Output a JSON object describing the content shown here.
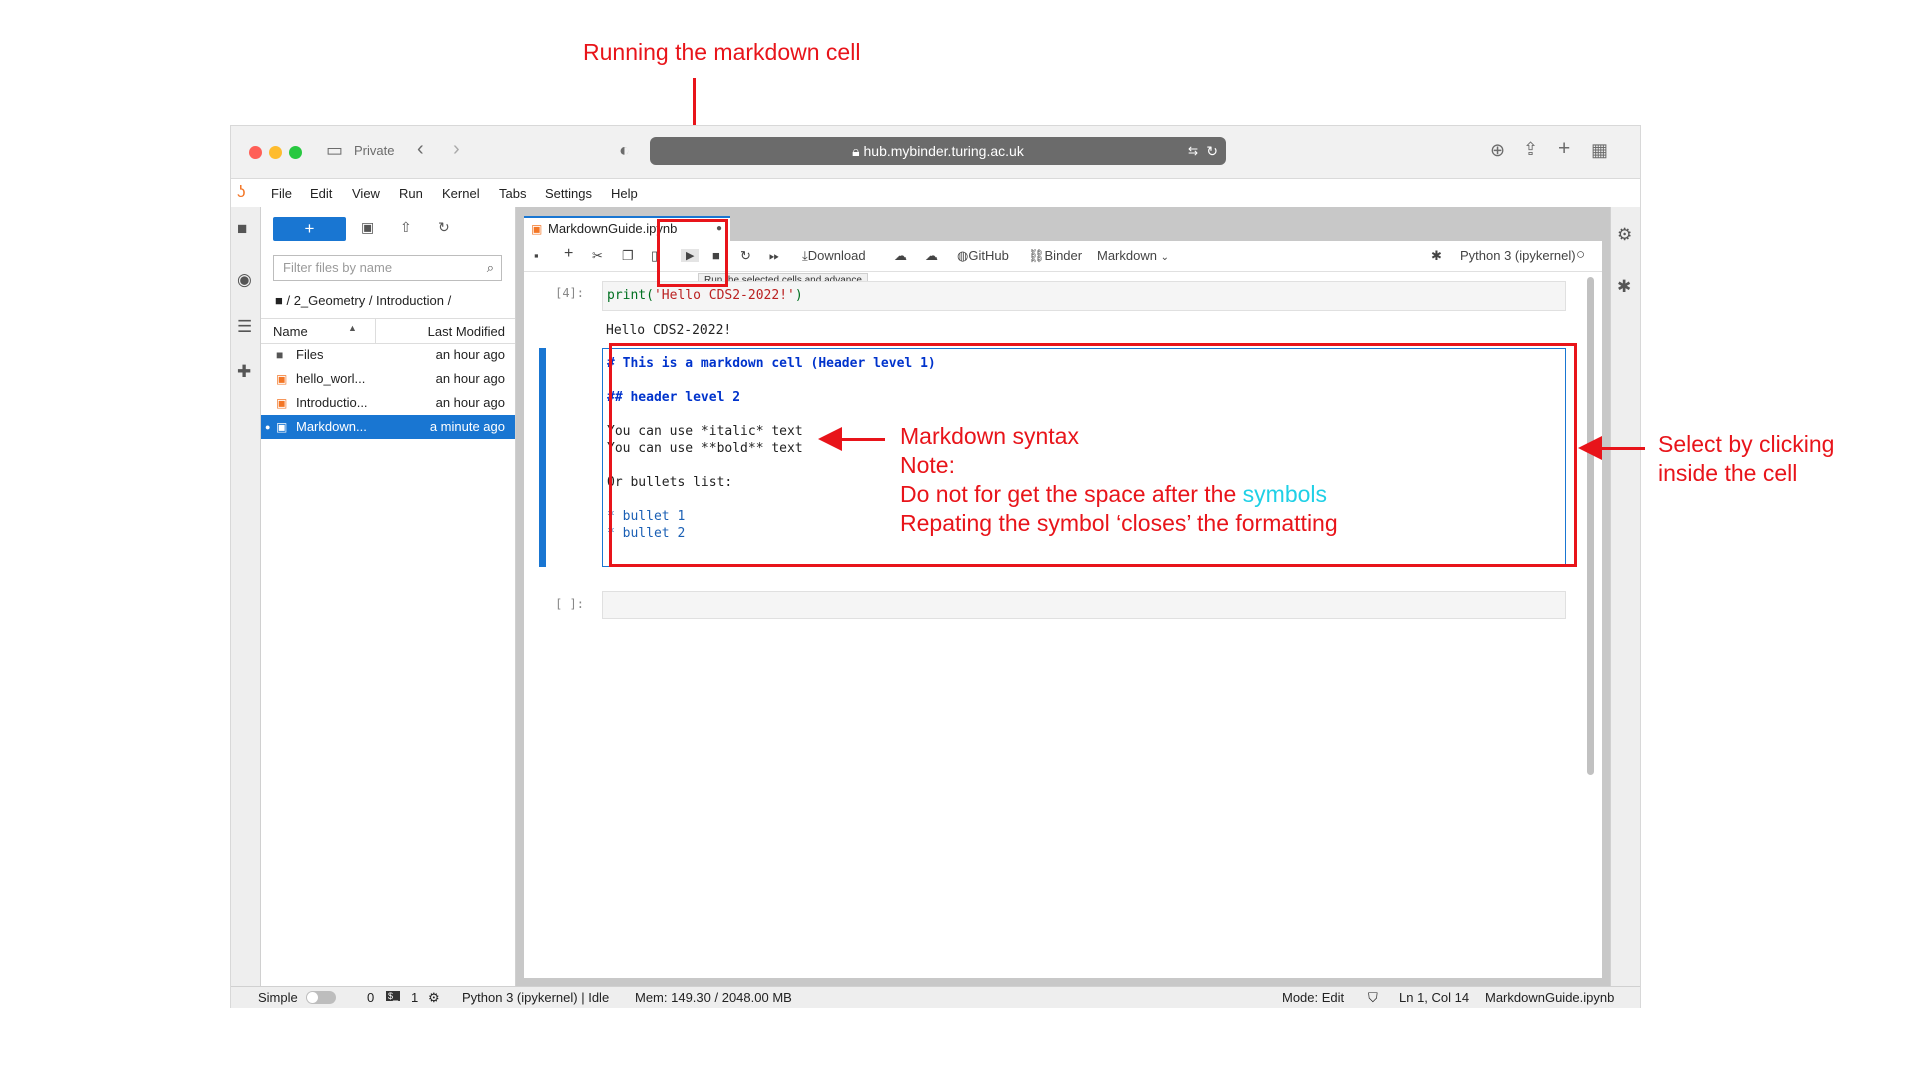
{
  "annotations": {
    "top_label": "Running the markdown cell",
    "syntax_title": "Markdown syntax",
    "note": "Note:",
    "space_note_prefix": "Do not for get the space  after the ",
    "space_note_highlight": "symbols",
    "repeat_note": "Repating the symbol ‘closes’ the formatting",
    "select_note_line1": "Select by clicking",
    "select_note_line2": "inside the cell"
  },
  "browser": {
    "private_label": "Private",
    "url": "hub.mybinder.turing.ac.uk",
    "lock_icon": "lock-icon"
  },
  "menu": [
    "File",
    "Edit",
    "View",
    "Run",
    "Kernel",
    "Tabs",
    "Settings",
    "Help"
  ],
  "filebrowser": {
    "new_label": "+",
    "filter_placeholder": "Filter files by name",
    "breadcrumb": "/ 2_Geometry / Introduction /",
    "col_name": "Name",
    "col_modified": "Last Modified",
    "rows": [
      {
        "name": "Files",
        "modified": "an hour ago"
      },
      {
        "name": "hello_worl...",
        "modified": "an hour ago"
      },
      {
        "name": "Introductio...",
        "modified": "an hour ago"
      },
      {
        "name": "Markdown...",
        "modified": "a minute ago"
      }
    ]
  },
  "notebook": {
    "tab_title": "MarkdownGuide.ipynb",
    "toolbar": {
      "download": "Download",
      "github": "GitHub",
      "binder": "Binder",
      "cell_type": "Markdown",
      "kernel": "Python 3 (ipykernel)"
    },
    "tooltip": "Run the selected cells and advance",
    "code_prompt": "[4]:",
    "code_src_fn": "print(",
    "code_src_str": "'Hello CDS2-2022!'",
    "code_src_end": ")",
    "code_output": "Hello CDS2-2022!",
    "md_lines": {
      "h1": "# This is a markdown cell (Header level 1)",
      "h2": "## header level 2",
      "italic": "You can use *italic* text",
      "bold": "You can use **bold** text",
      "bullets_intro": "Or bullets list:",
      "bullet1": "* bullet 1",
      "bullet2": "* bullet 2"
    },
    "empty_prompt": "[ ]:"
  },
  "status": {
    "simple": "Simple",
    "count1": "0",
    "count2": "1",
    "kernel_state": "Python 3 (ipykernel) | Idle",
    "mem": "Mem: 149.30 / 2048.00 MB",
    "mode": "Mode: Edit",
    "position": "Ln 1, Col 14",
    "filename": "MarkdownGuide.ipynb"
  }
}
